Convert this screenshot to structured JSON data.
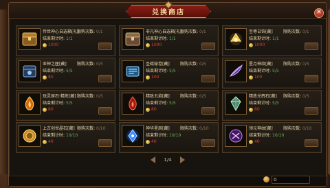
{
  "window": {
    "title": "兑换商店"
  },
  "labels": {
    "limit": "限购次数:",
    "count": "结束剩计时:"
  },
  "items": [
    {
      "name": "传世神心自选箱[礼]",
      "limit_val": "0/1",
      "count_val": "1/1",
      "price": "1000",
      "icon": "golden-chest-icon"
    },
    {
      "name": "非凡神心自选箱[礼]",
      "limit_val": "0/1",
      "count_val": "1/1",
      "price": "1000",
      "icon": "silver-chest-icon"
    },
    {
      "name": "至尊日饰[藏]",
      "limit_val": "0/1",
      "count_val": "1/1",
      "price": "1000",
      "icon": "gold-jewel-icon"
    },
    {
      "name": "亚神之匣[藏]",
      "limit_val": "0/5",
      "count_val": "5/5",
      "price": "80",
      "icon": "blue-box-icon"
    },
    {
      "name": "圣碳秘卷[藏]",
      "limit_val": "0/5",
      "count_val": "5/5",
      "price": "100",
      "icon": "blue-scroll-icon"
    },
    {
      "name": "星月神纹[藏]",
      "limit_val": "0/5",
      "count_val": "5/5",
      "price": "100",
      "icon": "purple-feather-icon"
    },
    {
      "name": "玩灵原石·精炼[藏]",
      "limit_val": "0/5",
      "count_val": "5/5",
      "price": "80",
      "icon": "fire-stone-icon"
    },
    {
      "name": "精致五焰[藏]",
      "limit_val": "0/5",
      "count_val": "5/5",
      "price": "80",
      "icon": "red-flame-icon"
    },
    {
      "name": "精炼光辉石[藏]",
      "limit_val": "0/5",
      "count_val": "5/5",
      "price": "80",
      "icon": "rainbow-crystal-icon"
    },
    {
      "name": "上古创世晶石[藏]",
      "limit_val": "0/10",
      "count_val": "10/10",
      "price": "40",
      "icon": "gold-coin-orb-icon"
    },
    {
      "name": "神华星辰[藏]",
      "limit_val": "0/10",
      "count_val": "10/10",
      "price": "40",
      "icon": "blue-crystal-icon"
    },
    {
      "name": "领元神纹[藏]",
      "limit_val": "0/10",
      "count_val": "10/10",
      "price": "40",
      "icon": "purple-rune-icon"
    }
  ],
  "pager": {
    "label": "1/4"
  },
  "footer": {
    "currency_value": "0"
  }
}
